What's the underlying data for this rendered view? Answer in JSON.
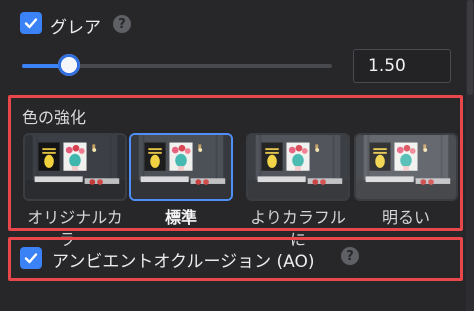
{
  "glare": {
    "label": "グレア",
    "checked": true,
    "help_icon": "?",
    "slider_fraction": 0.15,
    "value": "1.50"
  },
  "color_enhance": {
    "title": "色の強化",
    "presets": [
      {
        "label": "オリジナルカラー",
        "selected": false
      },
      {
        "label": "標準",
        "selected": true
      },
      {
        "label": "よりカラフルに",
        "selected": false
      },
      {
        "label": "明るい",
        "selected": false
      }
    ]
  },
  "ao": {
    "label": "アンビエントオクルージョン (AO)",
    "checked": true,
    "help_icon": "?"
  },
  "colors": {
    "accent": "#3b82f6",
    "highlight_frame": "#e8474c",
    "background": "#27272a"
  }
}
